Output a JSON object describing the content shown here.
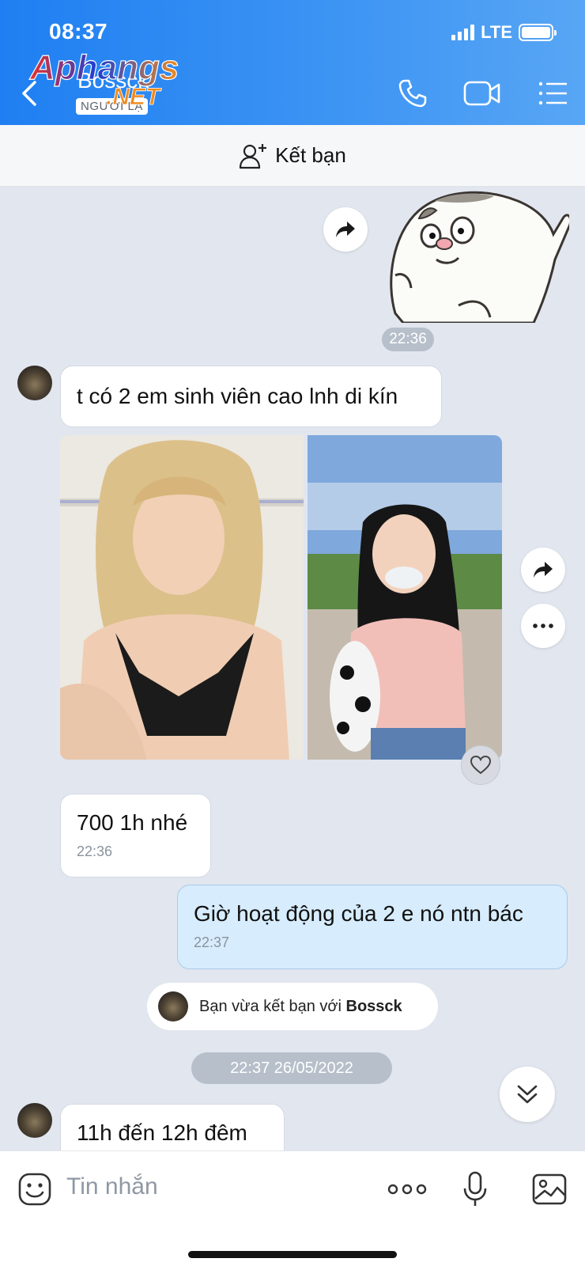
{
  "status_bar": {
    "time": "08:37",
    "network": "LTE",
    "battery_level": 1.0
  },
  "header": {
    "contact_name": "Bossck",
    "stranger_label": "NGƯỜI LẠ",
    "watermark_text": "Aphangs.NET",
    "icons": [
      "back-icon",
      "phone-icon",
      "video-icon",
      "menu-icon"
    ]
  },
  "add_friend": {
    "label": "Kết bạn",
    "icon": "add-user-icon"
  },
  "messages": {
    "time_1": "22:36",
    "text_1": "t có 2 em sinh viên cao lnh di kín",
    "text_2": "700 1h nhé",
    "text_2_time": "22:36",
    "mine_1": "Giờ hoạt động của 2 e nó ntn bác",
    "mine_1_time": "22:37",
    "system_prefix": "Bạn vừa kết bạn với",
    "system_name": "Bossck",
    "date_separator": "22:37 26/05/2022",
    "text_3": "11h đến 12h đêm"
  },
  "input": {
    "placeholder": "Tin nhắn"
  },
  "colors": {
    "header_blue": "#1f7ff2",
    "chat_bg": "#e1e6ef",
    "my_bubble": "#d7ecfd"
  }
}
